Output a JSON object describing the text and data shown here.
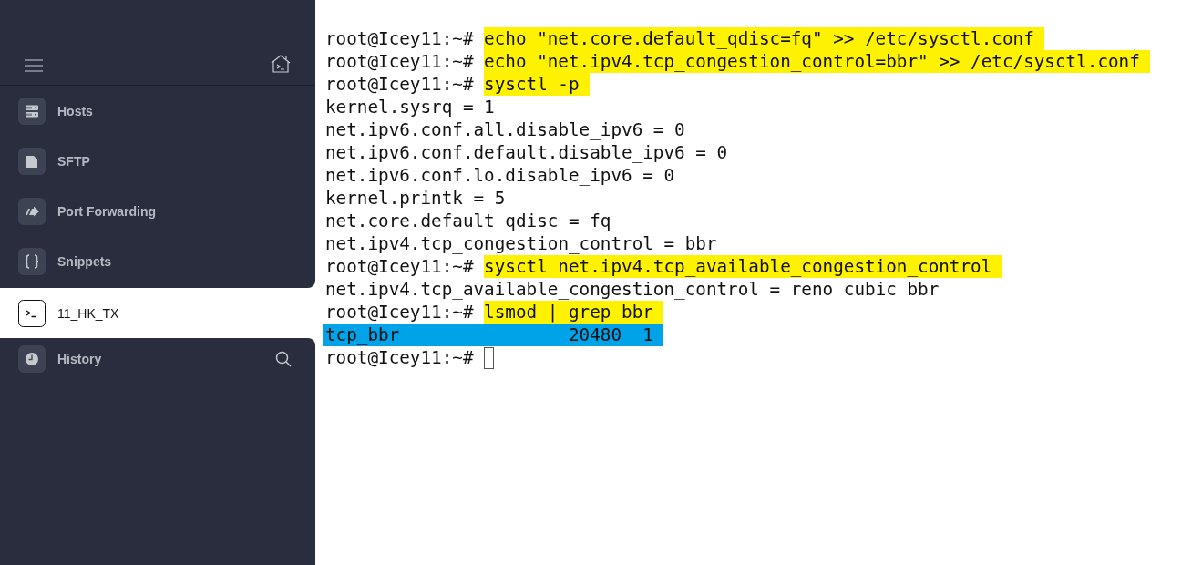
{
  "sidebar": {
    "nav": [
      {
        "label": "Hosts"
      },
      {
        "label": "SFTP"
      },
      {
        "label": "Port Forwarding"
      },
      {
        "label": "Snippets"
      }
    ],
    "sessions": [
      {
        "label": "11_HK_TX",
        "selected": true
      }
    ],
    "history": {
      "label": "History"
    }
  },
  "terminal": {
    "lines": [
      {
        "kind": "command",
        "prompt": "root@Icey11:~#",
        "command": "echo \"net.core.default_qdisc=fq\" >> /etc/sysctl.conf"
      },
      {
        "kind": "command",
        "prompt": "root@Icey11:~#",
        "command": "echo \"net.ipv4.tcp_congestion_control=bbr\" >> /etc/sysctl.conf"
      },
      {
        "kind": "command",
        "prompt": "root@Icey11:~#",
        "command": "sysctl -p"
      },
      {
        "kind": "output",
        "text": "kernel.sysrq = 1"
      },
      {
        "kind": "output",
        "text": "net.ipv6.conf.all.disable_ipv6 = 0"
      },
      {
        "kind": "output",
        "text": "net.ipv6.conf.default.disable_ipv6 = 0"
      },
      {
        "kind": "output",
        "text": "net.ipv6.conf.lo.disable_ipv6 = 0"
      },
      {
        "kind": "output",
        "text": "kernel.printk = 5"
      },
      {
        "kind": "output",
        "text": "net.core.default_qdisc = fq"
      },
      {
        "kind": "output",
        "text": "net.ipv4.tcp_congestion_control = bbr"
      },
      {
        "kind": "command",
        "prompt": "root@Icey11:~#",
        "command": "sysctl net.ipv4.tcp_available_congestion_control"
      },
      {
        "kind": "output",
        "text": "net.ipv4.tcp_available_congestion_control = reno cubic bbr"
      },
      {
        "kind": "command",
        "prompt": "root@Icey11:~#",
        "command": "lsmod | grep bbr"
      },
      {
        "kind": "selection",
        "text": "tcp_bbr                20480  1"
      },
      {
        "kind": "cursor",
        "prompt": "root@Icey11:~#"
      }
    ]
  }
}
